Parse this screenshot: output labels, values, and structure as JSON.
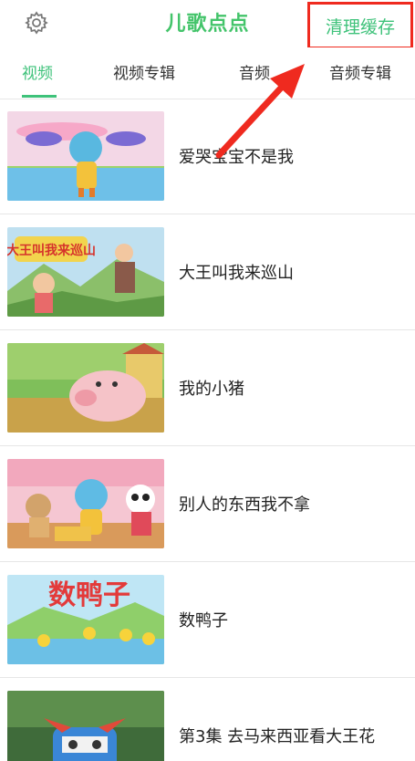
{
  "header": {
    "logo_text": "儿歌点点",
    "clear_cache_label": "清理缓存",
    "settings_icon": "gear-icon"
  },
  "tabs": [
    {
      "label": "视频",
      "active": true
    },
    {
      "label": "视频专辑",
      "active": false
    },
    {
      "label": "音频",
      "active": false
    },
    {
      "label": "音频专辑",
      "active": false
    }
  ],
  "videos": [
    {
      "title": "爱哭宝宝不是我"
    },
    {
      "title": "大王叫我来巡山"
    },
    {
      "title": "我的小猪"
    },
    {
      "title": "别人的东西我不拿"
    },
    {
      "title": "数鸭子"
    },
    {
      "title": "第3集 去马来西亚看大王花"
    }
  ],
  "thumb_text": {
    "t2": "大王叫我来巡山",
    "t5": "数鸭子"
  },
  "colors": {
    "accent": "#3ec27a",
    "highlight_box": "#ef2a1f"
  }
}
